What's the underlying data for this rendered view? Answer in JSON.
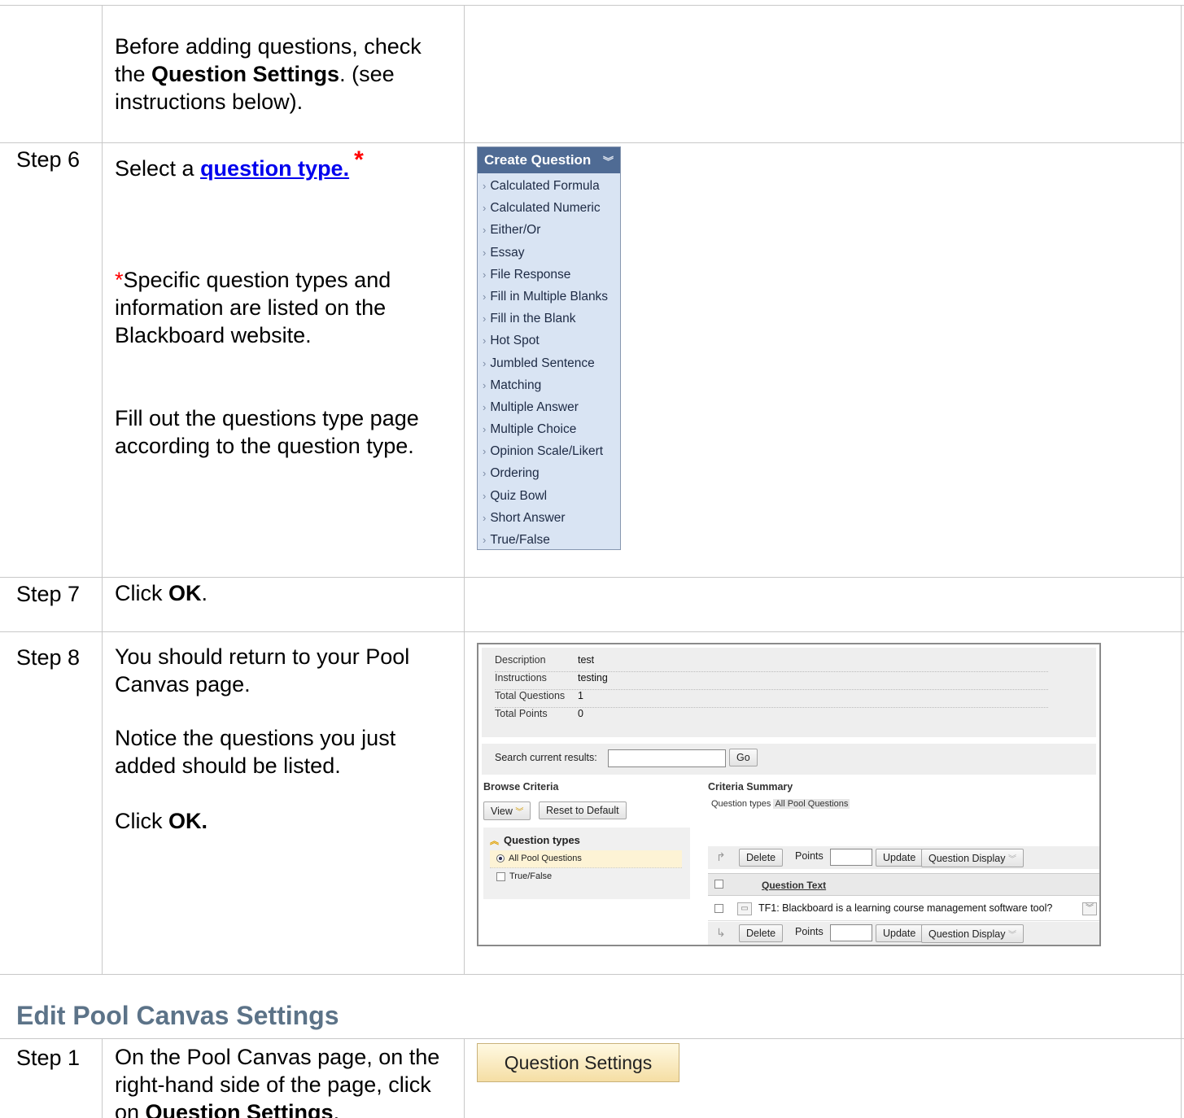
{
  "rows": {
    "intro": {
      "text_before": "Before adding questions, check the ",
      "bold": "Question Settings",
      "text_after": ". (see instructions below)."
    },
    "step6": {
      "label": "Step 6",
      "select_prefix": "Select a ",
      "link_text": "question type.",
      "star": "*",
      "note_star": "*",
      "note_text": "Specific question types and information are listed on the Blackboard website.",
      "fill_text": "Fill out the questions type page according to the question type."
    },
    "step7": {
      "label": "Step 7",
      "prefix": "Click ",
      "bold": "OK",
      "suffix": "."
    },
    "step8": {
      "label": "Step 8",
      "text1": "You should return to your Pool Canvas page.",
      "text2": "Notice the questions you just added should be listed.",
      "click_prefix": "Click ",
      "click_bold": "OK."
    }
  },
  "create_question_menu": {
    "title": "Create Question",
    "items": [
      "Calculated Formula",
      "Calculated Numeric",
      "Either/Or",
      "Essay",
      "File Response",
      "Fill in Multiple Blanks",
      "Fill in the Blank",
      "Hot Spot",
      "Jumbled Sentence",
      "Matching",
      "Multiple Answer",
      "Multiple Choice",
      "Opinion Scale/Likert",
      "Ordering",
      "Quiz Bowl",
      "Short Answer",
      "True/False"
    ]
  },
  "pool_canvas": {
    "info": [
      {
        "label": "Description",
        "value": "test"
      },
      {
        "label": "Instructions",
        "value": "testing"
      },
      {
        "label": "Total Questions",
        "value": "1"
      },
      {
        "label": "Total Points",
        "value": "0"
      }
    ],
    "search_label": "Search current results:",
    "go_label": "Go",
    "browse_criteria": "Browse Criteria",
    "view_label": "View",
    "reset_label": "Reset to Default",
    "question_types_heading": "Question types",
    "all_pool_questions": "All Pool Questions",
    "true_false": "True/False",
    "criteria_summary": "Criteria Summary",
    "criteria_sub_label": "Question types",
    "criteria_sub_tag": "All Pool Questions",
    "delete_label": "Delete",
    "points_label": "Points",
    "update_label": "Update",
    "question_display_label": "Question Display",
    "question_text_header": "Question Text",
    "question_row": "TF1: Blackboard is a learning course management software tool?"
  },
  "edit_section": {
    "title": "Edit Pool Canvas Settings",
    "step1_label": "Step 1",
    "step1_text": "On the Pool Canvas page, on the right-hand side of the page, click on ",
    "step1_bold": "Question Settings",
    "step1_suffix": ".",
    "button_label": "Question Settings"
  }
}
